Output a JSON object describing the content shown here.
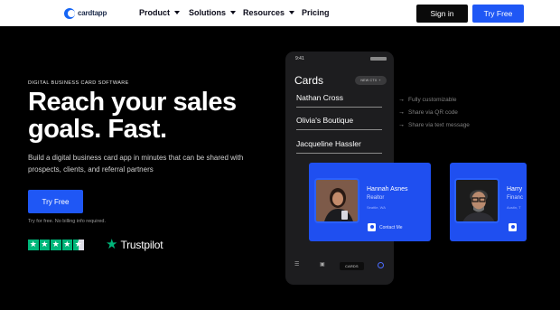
{
  "header": {
    "logo_text": "cardtapp",
    "nav": [
      {
        "label": "Product",
        "has_dropdown": true
      },
      {
        "label": "Solutions",
        "has_dropdown": true
      },
      {
        "label": "Resources",
        "has_dropdown": true
      },
      {
        "label": "Pricing",
        "has_dropdown": false
      }
    ],
    "signin_label": "Sign in",
    "tryfree_label": "Try Free"
  },
  "hero": {
    "eyebrow": "DIGITAL BUSINESS CARD SOFTWARE",
    "headline_line1": "Reach your sales",
    "headline_line2": "goals. Fast.",
    "subtext": "Build a digital business card app in minutes that can be shared with prospects, clients, and referral partners",
    "cta_label": "Try Free",
    "disclaimer": "Try for free. No billing info required.",
    "rating": {
      "stars_filled": 4.5,
      "stars_total": 5,
      "provider": "Trustpilot"
    }
  },
  "phone": {
    "time": "9:41",
    "title": "Cards",
    "pill_label": "NEW CTX",
    "rows": [
      "Nathan Cross",
      "Olivia's Boutique",
      "Jacqueline Hassler"
    ],
    "nav_cards_label": "CARDS"
  },
  "features": [
    "Fully customizable",
    "Share via QR code",
    "Share via text message"
  ],
  "cards": [
    {
      "name": "Hannah Asnes",
      "role": "Realtor",
      "location": "Seattle, WA",
      "contact_label": "Contact Me"
    },
    {
      "name": "Harry",
      "role": "Financ",
      "location": "Austin, T",
      "contact_label": ""
    }
  ],
  "colors": {
    "accent": "#1f57f5",
    "card_blue": "#1f4ff0",
    "trustpilot_green": "#00b67a",
    "background": "#000000"
  }
}
